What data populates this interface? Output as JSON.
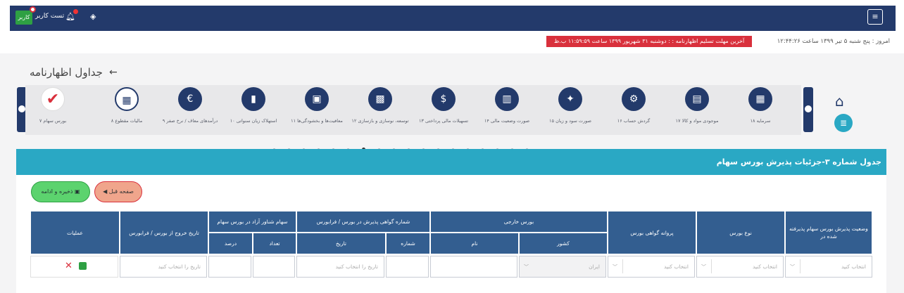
{
  "header": {
    "user_name": "تست کاربر",
    "user_btn": "کاربر"
  },
  "info": {
    "today": "امروز : پنج شنبه ۵ تیر ۱۳۹۹ ساعت ۱۲:۴۴:۲۶",
    "deadline": "آخرین مهلت تسلیم اظهارنامه : : دوشنبه ۳۱ شهریور ۱۳۹۹ ساعت ۱۱:۵۹:۵۹ ب.ظ"
  },
  "page": {
    "title": "جداول اظهارنامه"
  },
  "steps": [
    {
      "label": "۱۸ سرمایه",
      "icon": "▦"
    },
    {
      "label": "۱۷ موجودی مواد و کالا",
      "icon": "▤"
    },
    {
      "label": "۱۶ گردش حساب",
      "icon": "⚙"
    },
    {
      "label": "۱۵ صورت سود و زیان",
      "icon": "✦"
    },
    {
      "label": "۱۴ صورت وضعیت مالی",
      "icon": "▥"
    },
    {
      "label": "۱۳ تسهیلات مالی پرداختی",
      "icon": "$"
    },
    {
      "label": "۱۲ توسعه، نوسازی و بازسازی",
      "icon": "▩"
    },
    {
      "label": "۱۱ معافیت‌ها و بخشودگی‌ها",
      "icon": "▣"
    },
    {
      "label": "۱۰ استهلاک زیان سنواتی",
      "icon": "▮"
    },
    {
      "label": "۹ درآمدهای معاف / نرخ صفر",
      "icon": "€"
    },
    {
      "label": "۸ مالیات مقطوع",
      "icon": "▦"
    },
    {
      "label": "۷ بورس سهام",
      "icon": "✔"
    }
  ],
  "panel": {
    "title": "جدول شماره ۳-جزئیات پذیرش بورس سهام"
  },
  "buttons": {
    "prev": "صفحه قبل",
    "save": "ذخیره و ادامه"
  },
  "table": {
    "headers": {
      "status": "وضعیت پذیرش بورس سهام پذیرفته شده در",
      "type": "نوع بورس",
      "permit": "پروانه گواهی بورس",
      "foreign": "بورس خارجی",
      "country": "کشور",
      "name": "نام",
      "cert": "شماره گواهی پذیرش در بورس / فرابورس",
      "number": "شماره",
      "date": "تاریخ",
      "float": "سهام شناور آزاد در بورس سهام",
      "count": "تعداد",
      "percent": "درصد",
      "exit_date": "تاریخ خروج از بورس / فرابورس",
      "actions": "عملیات"
    },
    "row": {
      "status": "انتخاب کنید",
      "type": "انتخاب کنید",
      "permit": "انتخاب کنید",
      "country": "ایران",
      "date": "تاریخ را انتخاب کنید",
      "exit_date": "تاریخ را انتخاب کنید"
    }
  },
  "colors": {
    "navy": "#233a6b",
    "teal": "#2aa8c4",
    "red": "#d9303c",
    "green": "#2ea043"
  }
}
